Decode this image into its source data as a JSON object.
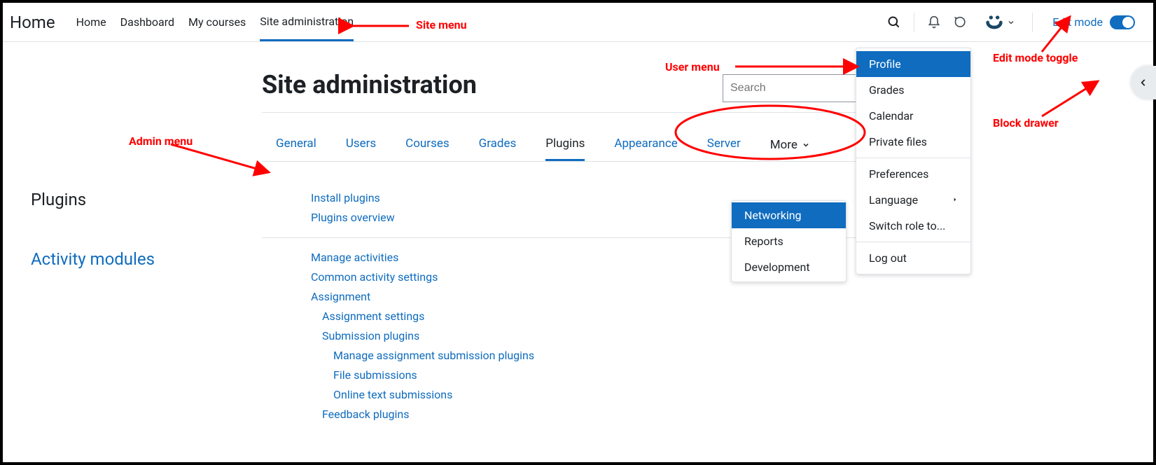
{
  "brand": "Home",
  "nav": [
    {
      "label": "Home"
    },
    {
      "label": "Dashboard"
    },
    {
      "label": "My courses"
    },
    {
      "label": "Site administration",
      "active": true
    }
  ],
  "editMode": {
    "label": "Edit mode",
    "on": true
  },
  "pageTitle": "Site administration",
  "search": {
    "placeholder": "Search"
  },
  "adminTabs": {
    "items": [
      {
        "label": "General",
        "state": "link"
      },
      {
        "label": "Users",
        "state": "link"
      },
      {
        "label": "Courses",
        "state": "link"
      },
      {
        "label": "Grades",
        "state": "link"
      },
      {
        "label": "Plugins",
        "state": "current"
      },
      {
        "label": "Appearance",
        "state": "link"
      },
      {
        "label": "Server",
        "state": "link"
      }
    ],
    "moreLabel": "More"
  },
  "moreMenu": [
    {
      "label": "Networking",
      "active": true
    },
    {
      "label": "Reports"
    },
    {
      "label": "Development"
    }
  ],
  "sections": [
    {
      "heading": "Plugins",
      "headingStyle": "plain",
      "links": [
        {
          "label": "Install plugins",
          "indent": 0
        },
        {
          "label": "Plugins overview",
          "indent": 0
        }
      ]
    },
    {
      "heading": "Activity modules",
      "headingStyle": "link",
      "links": [
        {
          "label": "Manage activities",
          "indent": 0
        },
        {
          "label": "Common activity settings",
          "indent": 0
        },
        {
          "label": "Assignment",
          "indent": 0
        },
        {
          "label": "Assignment settings",
          "indent": 1
        },
        {
          "label": "Submission plugins",
          "indent": 1
        },
        {
          "label": "Manage assignment submission plugins",
          "indent": 2
        },
        {
          "label": "File submissions",
          "indent": 2
        },
        {
          "label": "Online text submissions",
          "indent": 2
        },
        {
          "label": "Feedback plugins",
          "indent": 1
        }
      ]
    }
  ],
  "userMenu": [
    {
      "label": "Profile",
      "active": true
    },
    {
      "label": "Grades"
    },
    {
      "label": "Calendar"
    },
    {
      "label": "Private files"
    },
    {
      "type": "hr"
    },
    {
      "label": "Preferences"
    },
    {
      "label": "Language",
      "submenu": true
    },
    {
      "label": "Switch role to..."
    },
    {
      "type": "hr"
    },
    {
      "label": "Log out"
    }
  ],
  "annotations": {
    "siteMenu": "Site menu",
    "adminMenu": "Admin menu",
    "userMenu": "User menu",
    "editModeToggle": "Edit mode toggle",
    "blockDrawer": "Block drawer"
  }
}
